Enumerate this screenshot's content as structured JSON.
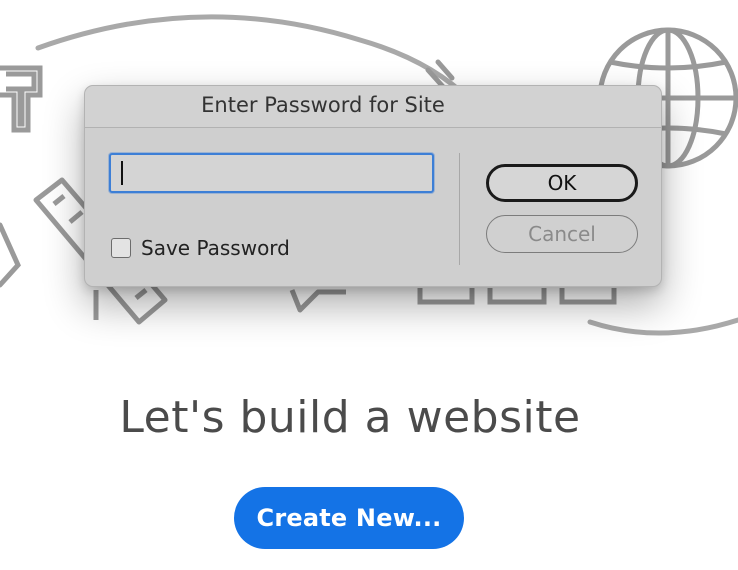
{
  "dialog": {
    "title": "Enter Password for Site",
    "password_value": "",
    "save_password_label": "Save Password",
    "save_password_checked": false,
    "ok_label": "OK",
    "cancel_label": "Cancel"
  },
  "main": {
    "headline": "Let's build a website",
    "create_button_label": "Create New..."
  },
  "colors": {
    "accent": "#1473e6",
    "focus_ring": "#3d7fd6",
    "dialog_bg": "#cfcfcf",
    "illustration_stroke": "#9a9a9a"
  },
  "icons": [
    "typography-icon",
    "pencil-icon",
    "ruler-icon",
    "globe-icon",
    "speech-bubble-icon",
    "layout-blocks-icon"
  ]
}
